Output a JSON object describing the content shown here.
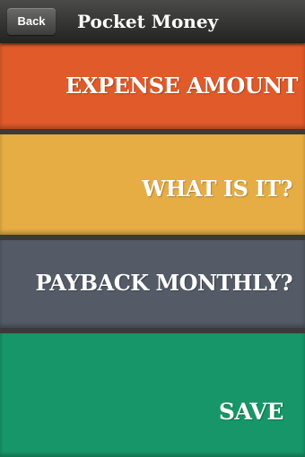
{
  "header": {
    "back_label": "Back",
    "title": "Pocket Money"
  },
  "form": {
    "expense_amount_label": "EXPENSE AMOUNT",
    "what_is_it_label": "WHAT IS IT?",
    "payback_label": "PAYBACK MONTHLY?",
    "save_label": "SAVE"
  },
  "colors": {
    "expense": "#e05a2a",
    "what": "#e6ad45",
    "payback": "#545b66",
    "save": "#17966a",
    "navbar": "#2f2f2e"
  }
}
